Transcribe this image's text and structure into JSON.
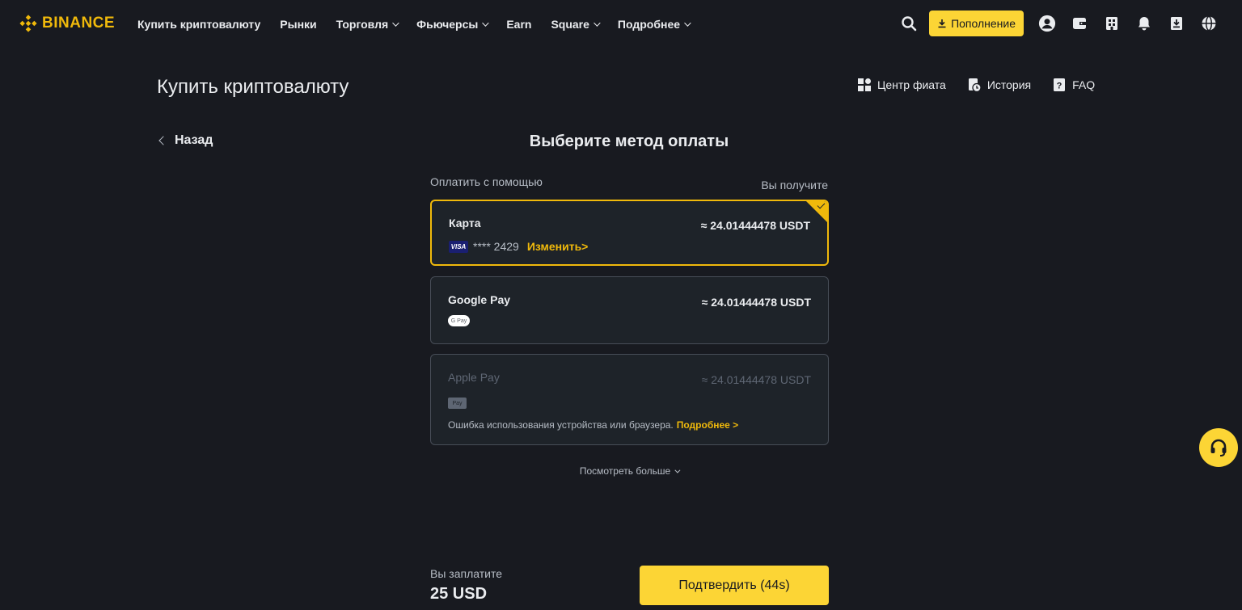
{
  "brand": {
    "name": "BINANCE",
    "color": "#f0b90b"
  },
  "nav": {
    "items": [
      {
        "label": "Купить криптовалюту",
        "dropdown": false
      },
      {
        "label": "Рынки",
        "dropdown": false
      },
      {
        "label": "Торговля",
        "dropdown": true
      },
      {
        "label": "Фьючерсы",
        "dropdown": true
      },
      {
        "label": "Earn",
        "dropdown": false
      },
      {
        "label": "Square",
        "dropdown": true
      },
      {
        "label": "Подробнее",
        "dropdown": true
      }
    ],
    "deposit_label": "Пополнение",
    "icons": [
      "search-icon",
      "download-icon",
      "user-icon",
      "wallet-icon",
      "orders-icon",
      "bell-icon",
      "app-download-icon",
      "globe-icon"
    ]
  },
  "page": {
    "title": "Купить криптовалюту",
    "links": [
      {
        "label": "Центр фиата",
        "icon": "grid-icon"
      },
      {
        "label": "История",
        "icon": "history-icon"
      },
      {
        "label": "FAQ",
        "icon": "faq-icon"
      }
    ],
    "back_label": "Назад",
    "section_title": "Выберите метод оплаты",
    "pay_with_label": "Оплатить с помощью",
    "you_get_label": "Вы получите"
  },
  "methods": {
    "card": {
      "title": "Карта",
      "amount": "≈  24.01444478 USDT",
      "brand_badge": "VISA",
      "masked_number": "**** 2429",
      "change_label": "Изменить>",
      "selected": true
    },
    "google_pay": {
      "title": "Google Pay",
      "amount": "≈  24.01444478 USDT",
      "badge": "G Pay"
    },
    "apple_pay": {
      "title": "Apple Pay",
      "amount": "≈  24.01444478 USDT",
      "badge": "Pay",
      "error_text": "Ошибка использования устройства или браузера.",
      "error_more": "Подробнее >",
      "disabled": true
    }
  },
  "see_more_label": "Посмотреть больше",
  "footer": {
    "you_pay_label": "Вы заплатите",
    "you_pay_value": "25 USD",
    "confirm_label": "Подтвердить (44s)"
  },
  "colors": {
    "accent": "#fcd535",
    "background": "#181a20",
    "card": "#1e2329",
    "border": "#474d57"
  }
}
